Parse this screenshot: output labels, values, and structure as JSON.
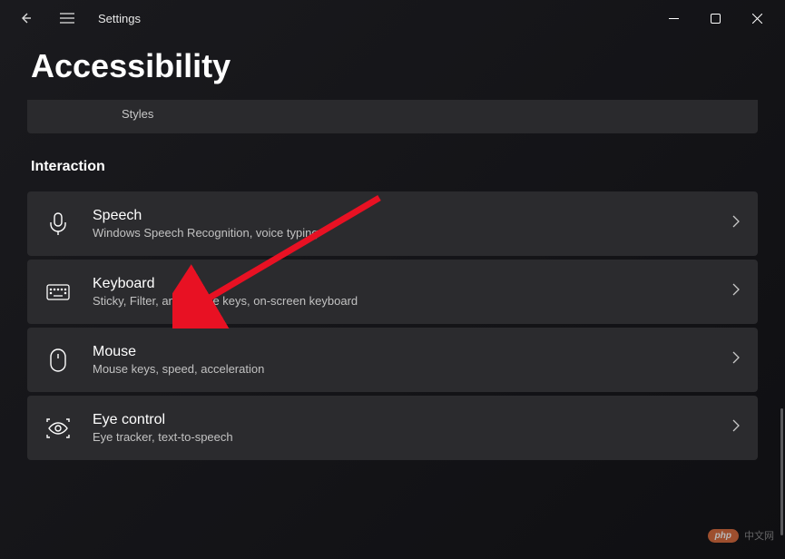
{
  "titlebar": {
    "app_name": "Settings"
  },
  "page": {
    "title": "Accessibility"
  },
  "partial_card": {
    "subtitle": "Styles"
  },
  "section": {
    "header": "Interaction"
  },
  "cards": {
    "speech": {
      "title": "Speech",
      "subtitle": "Windows Speech Recognition, voice typing"
    },
    "keyboard": {
      "title": "Keyboard",
      "subtitle": "Sticky, Filter, and Toggle keys, on-screen keyboard"
    },
    "mouse": {
      "title": "Mouse",
      "subtitle": "Mouse keys, speed, acceleration"
    },
    "eyecontrol": {
      "title": "Eye control",
      "subtitle": "Eye tracker, text-to-speech"
    }
  },
  "watermark": {
    "badge": "php",
    "text": "中文网"
  }
}
